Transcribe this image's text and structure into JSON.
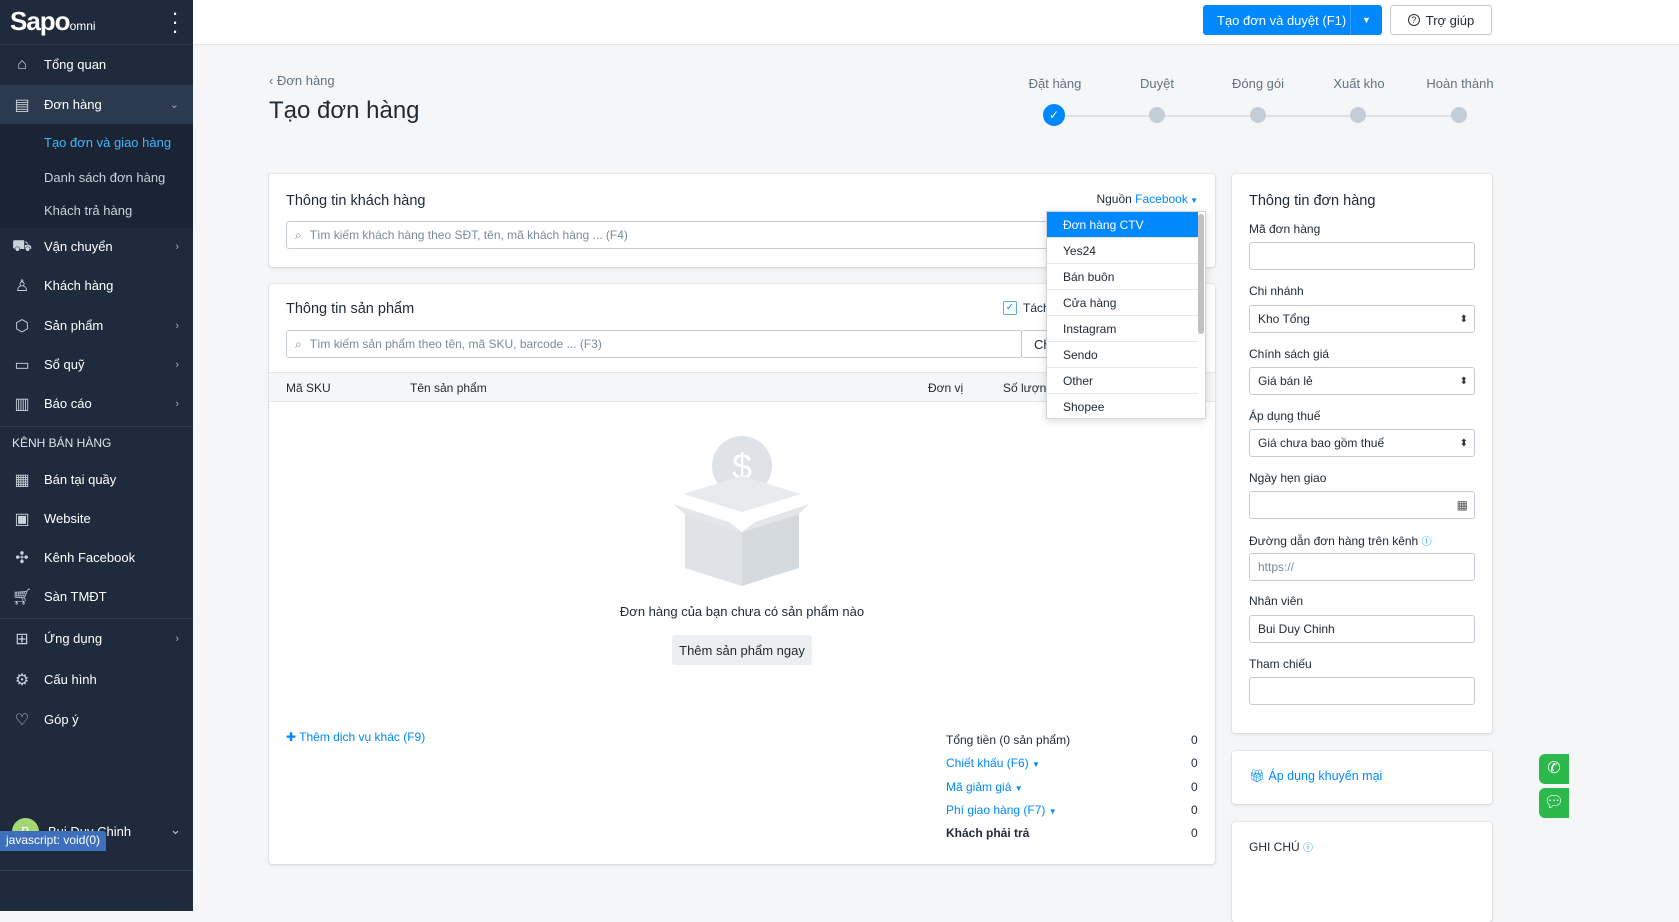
{
  "sidebar": {
    "logo": "Sapo",
    "logo_sub": "omni",
    "items": [
      {
        "label": "Tổng quan",
        "icon": "home-icon"
      },
      {
        "label": "Đơn hàng",
        "icon": "order-icon"
      },
      {
        "label": "Vận chuyển",
        "icon": "truck-icon"
      },
      {
        "label": "Khách hàng",
        "icon": "user-icon"
      },
      {
        "label": "Sản phẩm",
        "icon": "box-icon"
      },
      {
        "label": "Sổ quỹ",
        "icon": "cash-icon"
      },
      {
        "label": "Báo cáo",
        "icon": "chart-icon"
      }
    ],
    "subitems": [
      "Tạo đơn và giao hàng",
      "Danh sách đơn hàng",
      "Khách trả hàng"
    ],
    "section": "KÊNH BÁN HÀNG",
    "channels": [
      {
        "label": "Bán tại quầy"
      },
      {
        "label": "Website"
      },
      {
        "label": "Kênh Facebook"
      },
      {
        "label": "Sàn TMĐT"
      }
    ],
    "bottom": [
      {
        "label": "Ứng dụng"
      },
      {
        "label": "Cấu hình"
      },
      {
        "label": "Góp ý"
      }
    ],
    "user": "Bui Duy Chinh",
    "avatar": "B"
  },
  "status_bar": "javascript: void(0)",
  "topbar": {
    "create_approve": "Tạo đơn và duyệt (F1)",
    "help": "Trợ giúp"
  },
  "page": {
    "breadcrumb": "Đơn hàng",
    "title": "Tạo đơn hàng"
  },
  "steps": [
    "Đặt hàng",
    "Duyệt",
    "Đóng gói",
    "Xuất kho",
    "Hoàn thành"
  ],
  "customer": {
    "title": "Thông tin khách hàng",
    "source_label": "Nguồn",
    "source_value": "Facebook",
    "search_placeholder": "Tìm kiếm khách hàng theo SĐT, tên, mã khách hàng ... (F4)"
  },
  "source_options": [
    "Đơn hàng CTV",
    "Yes24",
    "Bán buôn",
    "Cửa hàng",
    "Instagram",
    "Sendo",
    "Other",
    "Shopee"
  ],
  "products": {
    "title": "Thông tin sản phẩm",
    "split_label": "Tách",
    "search_placeholder": "Tìm kiếm sản phẩm theo tên, mã SKU, barcode ... (F3)",
    "choose": "Ch",
    "columns": [
      "Mã SKU",
      "Tên sản phẩm",
      "Đơn vị",
      "Số lượng"
    ],
    "empty": "Đơn hàng của bạn chưa có sản phẩm nào",
    "add_now": "Thêm sản phẩm ngay",
    "add_service": "Thêm dịch vụ khác (F9)"
  },
  "totals": [
    {
      "label": "Tổng tiền (0 sản phẩm)",
      "value": "0",
      "link": false
    },
    {
      "label": "Chiết khấu (F6)",
      "value": "0",
      "link": true
    },
    {
      "label": "Mã giảm giá",
      "value": "0",
      "link": true
    },
    {
      "label": "Phí giao hàng (F7)",
      "value": "0",
      "link": true
    },
    {
      "label": "Khách phải trả",
      "value": "0",
      "link": false
    }
  ],
  "order_info": {
    "title": "Thông tin đơn hàng",
    "code_label": "Mã đơn hàng",
    "code_value": "",
    "branch_label": "Chi nhánh",
    "branch_value": "Kho Tổng",
    "price_label": "Chính sách giá",
    "price_value": "Giá bán lẻ",
    "tax_label": "Áp dụng thuế",
    "tax_value": "Giá chưa bao gồm thuế",
    "date_label": "Ngày hẹn giao",
    "url_label": "Đường dẫn đơn hàng trên kênh",
    "url_placeholder": "https://",
    "staff_label": "Nhân viên",
    "staff_value": "Bui Duy Chinh",
    "ref_label": "Tham chiếu"
  },
  "promo": "Áp dụng khuyến mại",
  "note": "GHI CHÚ"
}
